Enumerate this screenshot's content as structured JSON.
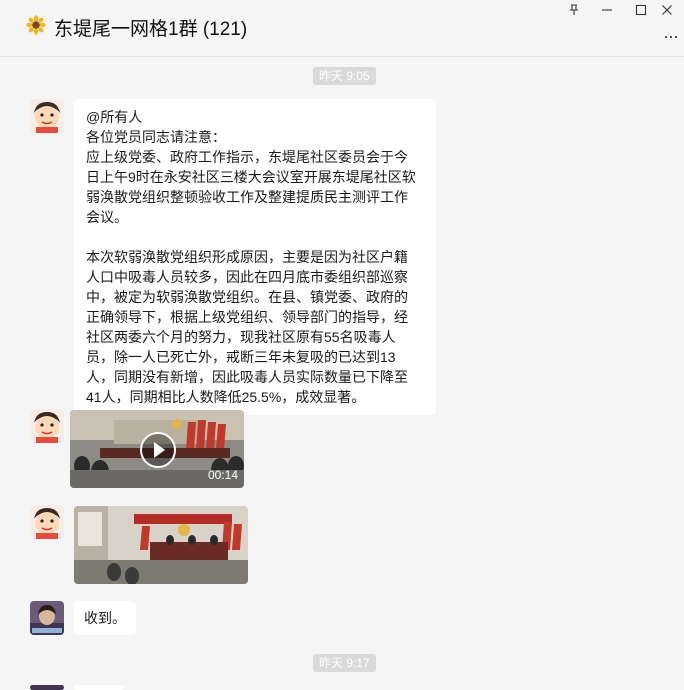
{
  "window": {
    "title": "东堤尾一网格1群 (121)",
    "controls": [
      "pin",
      "minimize",
      "maximize",
      "close"
    ]
  },
  "timestamps": [
    "昨天 9:05",
    "昨天 9:17"
  ],
  "messages": [
    {
      "type": "text",
      "paragraphs": [
        "@所有人",
        "各位党员同志请注意：",
        "应上级党委、政府工作指示，东堤尾社区委员会于今日上午9时在永安社区三楼大会议室开展东堤尾社区软弱涣散党组织整顿验收工作及整建提质民主测评工作会议。",
        "",
        "本次软弱涣散党组织形成原因，主要是因为社区户籍人口中吸毒人员较多，因此在四月底市委组织部巡察中，被定为软弱涣散党组织。在县、镇党委、政府的正确领导下，根据上级党组织、领导部门的指导，经社区两委六个月的努力，现我社区原有55名吸毒人员，除一人已死亡外，戒断三年未复吸的已达到13人，同期没有新增，因此吸毒人员实际数量已下降至41人，同期相比人数降低25.5%，成效显著。"
      ]
    },
    {
      "type": "video",
      "duration": "00:14"
    },
    {
      "type": "image"
    },
    {
      "type": "text",
      "text": "收到。"
    }
  ],
  "colors": {
    "background": "#f5f5f5",
    "bubble": "#ffffff",
    "timestamp_bg": "#dadada"
  }
}
